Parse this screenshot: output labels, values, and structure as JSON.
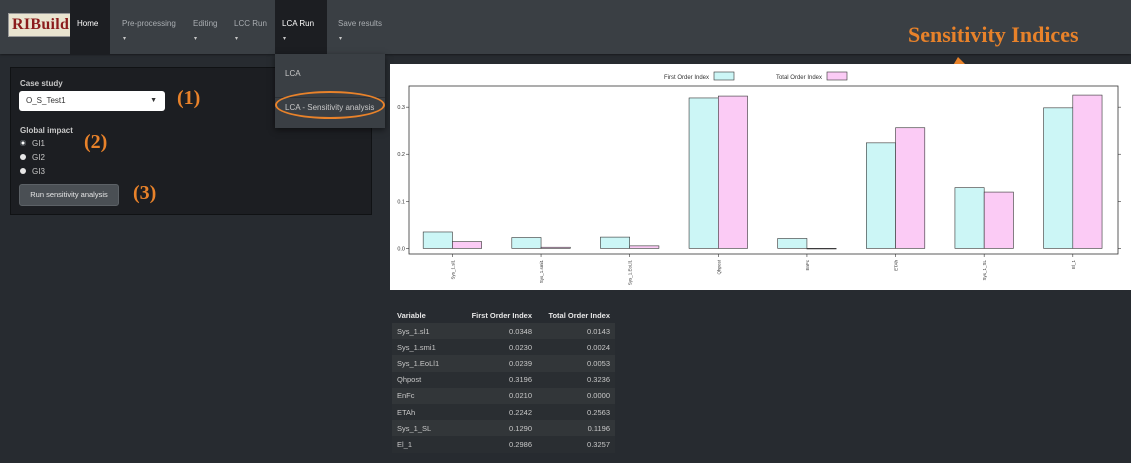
{
  "brand": "RIBuild",
  "nav": {
    "items": [
      {
        "label": "Home",
        "caret": ""
      },
      {
        "label": "Pre-processing",
        "caret": "▾"
      },
      {
        "label": "Editing",
        "caret": "▾"
      },
      {
        "label": "LCC Run",
        "caret": "▾"
      },
      {
        "label": "LCA Run",
        "caret": "▾"
      },
      {
        "label": "Save results",
        "caret": "▾"
      }
    ]
  },
  "dropdown": {
    "items": [
      "LCA",
      "LCA - Sensitivity analysis"
    ]
  },
  "headline": "Sensitivity Indices",
  "panel": {
    "case_study_label": "Case study",
    "case_study_value": "O_S_Test1",
    "global_impact_label": "Global impact",
    "radios": [
      "GI1",
      "GI2",
      "GI3"
    ],
    "selected_radio": "GI1",
    "run_button": "Run sensitivity analysis"
  },
  "callouts": [
    "(1)",
    "(2)",
    "(3)"
  ],
  "colors": {
    "accent": "#e8822a",
    "first_order": "#ccf6f6",
    "total_order": "#fbcbf5"
  },
  "chart_data": {
    "type": "bar",
    "categories": [
      "Sys_1.sl1",
      "Sys_1.smi1",
      "Sys_1.EoLl1",
      "Qhpost",
      "EnFc",
      "ETAh",
      "Sys_1_SL",
      "El_1"
    ],
    "series": [
      {
        "name": "First Order Index",
        "values": [
          0.0348,
          0.023,
          0.0239,
          0.3196,
          0.021,
          0.2242,
          0.129,
          0.2986
        ]
      },
      {
        "name": "Total Order Index",
        "values": [
          0.0143,
          0.0024,
          0.0053,
          0.3236,
          0.0,
          0.2563,
          0.1196,
          0.3257
        ]
      }
    ],
    "yticks": [
      "0.0",
      "0.1",
      "0.2",
      "0.3"
    ],
    "ylim": [
      -0.012,
      0.345
    ],
    "legend": "top-center",
    "grid": false
  },
  "table": {
    "headers": [
      "Variable",
      "First Order Index",
      "Total Order Index"
    ],
    "rows": [
      [
        "Sys_1.sl1",
        "0.0348",
        "0.0143"
      ],
      [
        "Sys_1.smi1",
        "0.0230",
        "0.0024"
      ],
      [
        "Sys_1.EoLl1",
        "0.0239",
        "0.0053"
      ],
      [
        "Qhpost",
        "0.3196",
        "0.3236"
      ],
      [
        "EnFc",
        "0.0210",
        "0.0000"
      ],
      [
        "ETAh",
        "0.2242",
        "0.2563"
      ],
      [
        "Sys_1_SL",
        "0.1290",
        "0.1196"
      ],
      [
        "El_1",
        "0.2986",
        "0.3257"
      ]
    ]
  }
}
